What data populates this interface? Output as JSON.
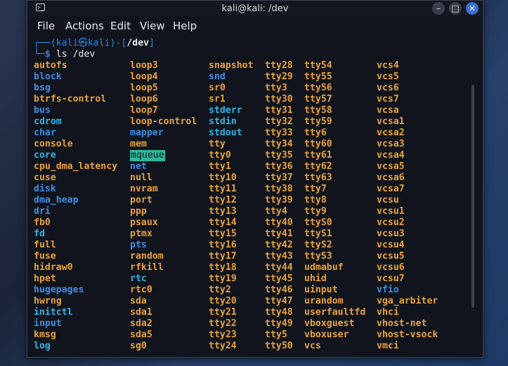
{
  "window": {
    "title": "kali@kali: /dev",
    "terminal_icon": ">_",
    "minimize": "–",
    "maximize": "□",
    "close": "✕"
  },
  "menu": [
    "File",
    "Actions",
    "Edit",
    "View",
    "Help"
  ],
  "prompt": {
    "open": "┌──(",
    "user": "kali",
    "at": "㉿",
    "host": "kali",
    "sep": ")-[",
    "path": "/dev",
    "close": "]",
    "line2_prefix": "└─",
    "dollar": "$",
    "command": "ls /dev"
  },
  "listing": [
    [
      [
        "autofs",
        "dev"
      ],
      [
        "block",
        "dir"
      ],
      [
        "bsg",
        "dir"
      ],
      [
        "btrfs-control",
        "dev"
      ],
      [
        "bus",
        "dir"
      ],
      [
        "cdrom",
        "link"
      ],
      [
        "char",
        "dir"
      ],
      [
        "console",
        "dev"
      ],
      [
        "core",
        "link"
      ],
      [
        "cpu_dma_latency",
        "dev"
      ],
      [
        "cuse",
        "dev"
      ],
      [
        "disk",
        "dir"
      ],
      [
        "dma_heap",
        "dir"
      ],
      [
        "dri",
        "dir"
      ],
      [
        "fb0",
        "dev"
      ],
      [
        "fd",
        "link"
      ],
      [
        "full",
        "dev"
      ],
      [
        "fuse",
        "dev"
      ],
      [
        "hidraw0",
        "dev"
      ],
      [
        "hpet",
        "dev"
      ],
      [
        "hugepages",
        "dir"
      ],
      [
        "hwrng",
        "dev"
      ],
      [
        "initctl",
        "link"
      ],
      [
        "input",
        "dir"
      ],
      [
        "kmsg",
        "dev"
      ],
      [
        "log",
        "link"
      ]
    ],
    [
      [
        "loop3",
        "dev"
      ],
      [
        "loop4",
        "dev"
      ],
      [
        "loop5",
        "dev"
      ],
      [
        "loop6",
        "dev"
      ],
      [
        "loop7",
        "dev"
      ],
      [
        "loop-control",
        "dev"
      ],
      [
        "mapper",
        "dir"
      ],
      [
        "mem",
        "dev"
      ],
      [
        "mqueue",
        "hl"
      ],
      [
        "net",
        "dir"
      ],
      [
        "null",
        "dev"
      ],
      [
        "nvram",
        "dev"
      ],
      [
        "port",
        "dev"
      ],
      [
        "ppp",
        "dev"
      ],
      [
        "psaux",
        "dev"
      ],
      [
        "ptmx",
        "dev"
      ],
      [
        "pts",
        "dir"
      ],
      [
        "random",
        "dev"
      ],
      [
        "rfkill",
        "dev"
      ],
      [
        "rtc",
        "link"
      ],
      [
        "rtc0",
        "dev"
      ],
      [
        "sda",
        "dev"
      ],
      [
        "sda1",
        "dev"
      ],
      [
        "sda2",
        "dev"
      ],
      [
        "sda5",
        "dev"
      ],
      [
        "sg0",
        "dev"
      ]
    ],
    [
      [
        "snapshot",
        "dev"
      ],
      [
        "snd",
        "dir"
      ],
      [
        "sr0",
        "dev"
      ],
      [
        "sr1",
        "dev"
      ],
      [
        "stderr",
        "link"
      ],
      [
        "stdin",
        "link"
      ],
      [
        "stdout",
        "link"
      ],
      [
        "tty",
        "dev"
      ],
      [
        "tty0",
        "dev"
      ],
      [
        "tty1",
        "dev"
      ],
      [
        "tty10",
        "dev"
      ],
      [
        "tty11",
        "dev"
      ],
      [
        "tty12",
        "dev"
      ],
      [
        "tty13",
        "dev"
      ],
      [
        "tty14",
        "dev"
      ],
      [
        "tty15",
        "dev"
      ],
      [
        "tty16",
        "dev"
      ],
      [
        "tty17",
        "dev"
      ],
      [
        "tty18",
        "dev"
      ],
      [
        "tty19",
        "dev"
      ],
      [
        "tty2",
        "dev"
      ],
      [
        "tty20",
        "dev"
      ],
      [
        "tty21",
        "dev"
      ],
      [
        "tty22",
        "dev"
      ],
      [
        "tty23",
        "dev"
      ],
      [
        "tty24",
        "dev"
      ]
    ],
    [
      [
        "tty28",
        "dev"
      ],
      [
        "tty29",
        "dev"
      ],
      [
        "tty3",
        "dev"
      ],
      [
        "tty30",
        "dev"
      ],
      [
        "tty31",
        "dev"
      ],
      [
        "tty32",
        "dev"
      ],
      [
        "tty33",
        "dev"
      ],
      [
        "tty34",
        "dev"
      ],
      [
        "tty35",
        "dev"
      ],
      [
        "tty36",
        "dev"
      ],
      [
        "tty37",
        "dev"
      ],
      [
        "tty38",
        "dev"
      ],
      [
        "tty39",
        "dev"
      ],
      [
        "tty4",
        "dev"
      ],
      [
        "tty40",
        "dev"
      ],
      [
        "tty41",
        "dev"
      ],
      [
        "tty42",
        "dev"
      ],
      [
        "tty43",
        "dev"
      ],
      [
        "tty44",
        "dev"
      ],
      [
        "tty45",
        "dev"
      ],
      [
        "tty46",
        "dev"
      ],
      [
        "tty47",
        "dev"
      ],
      [
        "tty48",
        "dev"
      ],
      [
        "tty49",
        "dev"
      ],
      [
        "tty5",
        "dev"
      ],
      [
        "tty50",
        "dev"
      ]
    ],
    [
      [
        "tty54",
        "dev"
      ],
      [
        "tty55",
        "dev"
      ],
      [
        "tty56",
        "dev"
      ],
      [
        "tty57",
        "dev"
      ],
      [
        "tty58",
        "dev"
      ],
      [
        "tty59",
        "dev"
      ],
      [
        "tty6",
        "dev"
      ],
      [
        "tty60",
        "dev"
      ],
      [
        "tty61",
        "dev"
      ],
      [
        "tty62",
        "dev"
      ],
      [
        "tty63",
        "dev"
      ],
      [
        "tty7",
        "dev"
      ],
      [
        "tty8",
        "dev"
      ],
      [
        "tty9",
        "dev"
      ],
      [
        "ttyS0",
        "dev"
      ],
      [
        "ttyS1",
        "dev"
      ],
      [
        "ttyS2",
        "dev"
      ],
      [
        "ttyS3",
        "dev"
      ],
      [
        "udmabuf",
        "dev"
      ],
      [
        "uhid",
        "dev"
      ],
      [
        "uinput",
        "dev"
      ],
      [
        "urandom",
        "dev"
      ],
      [
        "userfaultfd",
        "dev"
      ],
      [
        "vboxguest",
        "dev"
      ],
      [
        "vboxuser",
        "dev"
      ],
      [
        "vcs",
        "dev"
      ]
    ],
    [
      [
        "vcs4",
        "dev"
      ],
      [
        "vcs5",
        "dev"
      ],
      [
        "vcs6",
        "dev"
      ],
      [
        "vcs7",
        "dev"
      ],
      [
        "vcsa",
        "dev"
      ],
      [
        "vcsa1",
        "dev"
      ],
      [
        "vcsa2",
        "dev"
      ],
      [
        "vcsa3",
        "dev"
      ],
      [
        "vcsa4",
        "dev"
      ],
      [
        "vcsa5",
        "dev"
      ],
      [
        "vcsa6",
        "dev"
      ],
      [
        "vcsa7",
        "dev"
      ],
      [
        "vcsu",
        "dev"
      ],
      [
        "vcsu1",
        "dev"
      ],
      [
        "vcsu2",
        "dev"
      ],
      [
        "vcsu3",
        "dev"
      ],
      [
        "vcsu4",
        "dev"
      ],
      [
        "vcsu5",
        "dev"
      ],
      [
        "vcsu6",
        "dev"
      ],
      [
        "vcsu7",
        "dev"
      ],
      [
        "vfio",
        "dir"
      ],
      [
        "vga_arbiter",
        "dev"
      ],
      [
        "vhci",
        "dev"
      ],
      [
        "vhost-net",
        "dev"
      ],
      [
        "vhost-vsock",
        "dev"
      ],
      [
        "vmci",
        "dev"
      ]
    ]
  ],
  "colors": {
    "dir": "#3f8fe6",
    "dev": "#e8a33a",
    "link": "#2fb7e6",
    "highlight_bg": "#2fb79c",
    "terminal_bg": "#11141d"
  }
}
